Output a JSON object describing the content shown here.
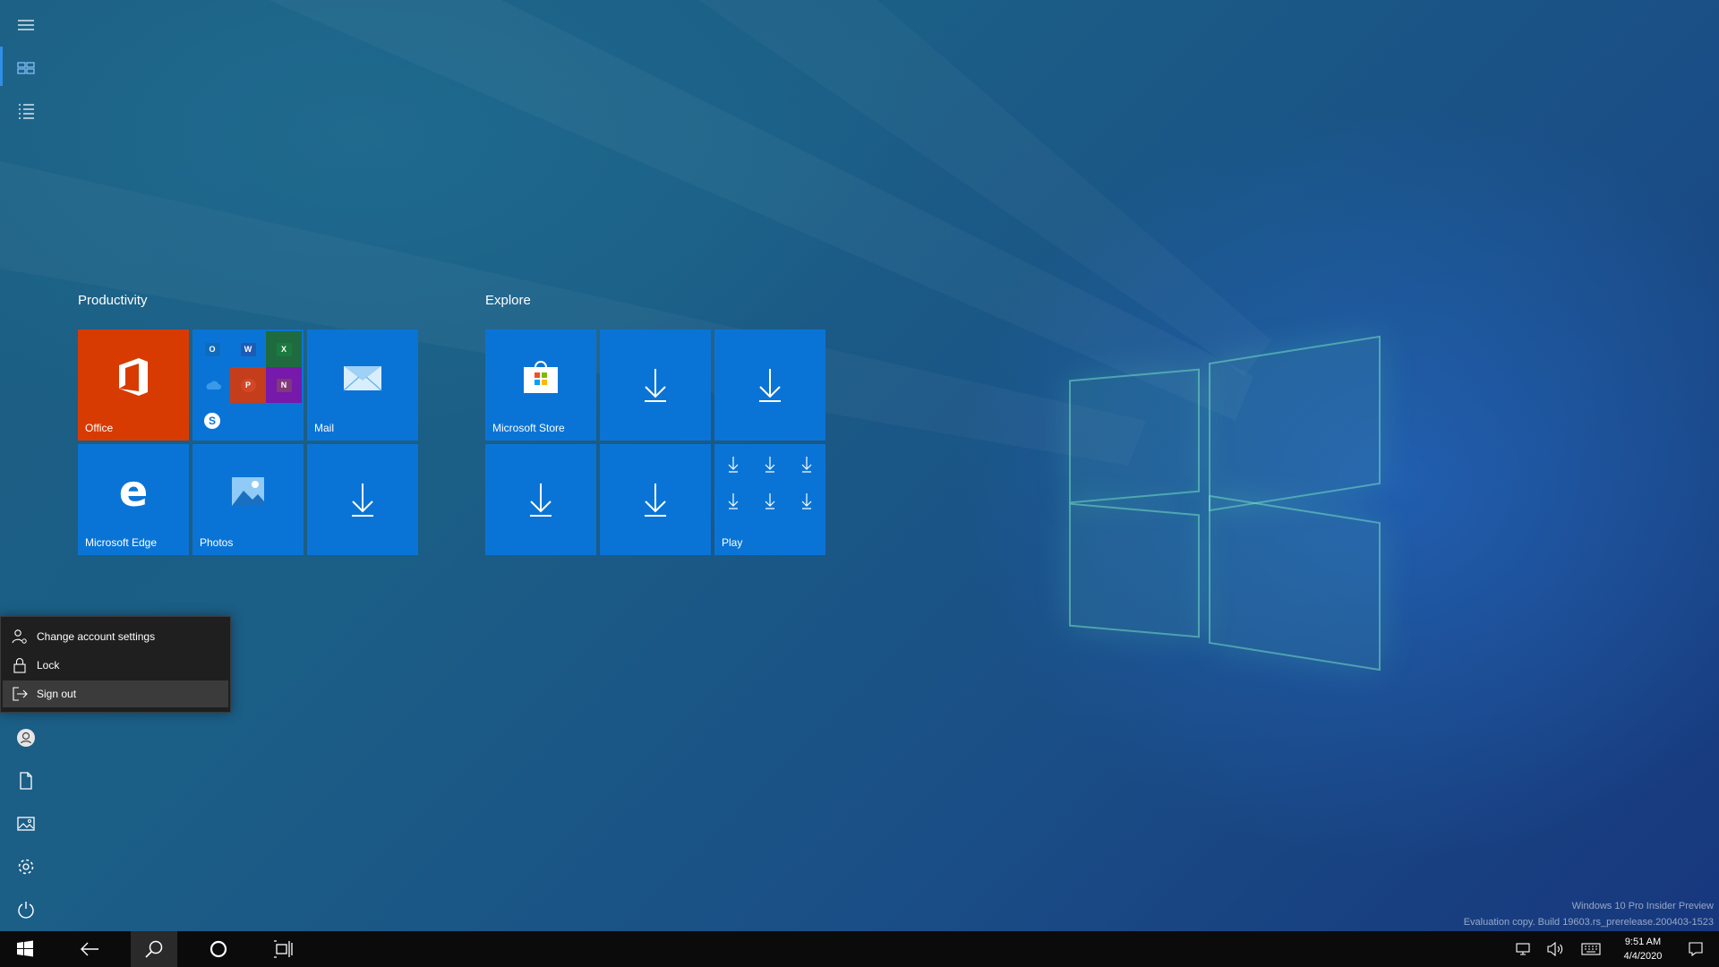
{
  "start_menu": {
    "groups": [
      {
        "title": "Productivity",
        "tiles": [
          {
            "label": "Office",
            "icon": "office-icon"
          },
          {
            "label": "",
            "icon": "office-apps-folder-icon"
          },
          {
            "label": "Mail",
            "icon": "mail-icon"
          },
          {
            "label": "Microsoft Edge",
            "icon": "edge-icon"
          },
          {
            "label": "Photos",
            "icon": "photos-icon"
          },
          {
            "label": "",
            "icon": "download-icon"
          }
        ]
      },
      {
        "title": "Explore",
        "tiles": [
          {
            "label": "Microsoft Store",
            "icon": "store-icon"
          },
          {
            "label": "",
            "icon": "download-icon"
          },
          {
            "label": "",
            "icon": "download-icon"
          },
          {
            "label": "",
            "icon": "download-icon"
          },
          {
            "label": "",
            "icon": "download-icon"
          },
          {
            "label": "Play",
            "icon": "download-folder-icon"
          }
        ]
      }
    ],
    "folder_apps": [
      "O",
      "W",
      "X",
      "",
      "P",
      "N",
      "S"
    ],
    "rail_icons": [
      "hamburger-icon",
      "pinned-tiles-icon",
      "all-apps-list-icon",
      "user-icon",
      "documents-icon",
      "pictures-icon",
      "settings-gear-icon",
      "power-icon"
    ]
  },
  "account_flyout": {
    "items": [
      {
        "label": "Change account settings",
        "icon": "person-settings-icon"
      },
      {
        "label": "Lock",
        "icon": "lock-icon"
      },
      {
        "label": "Sign out",
        "icon": "sign-out-icon"
      }
    ]
  },
  "watermark": {
    "line1": "Windows 10 Pro Insider Preview",
    "line2": "Evaluation copy. Build 19603.rs_prerelease.200403-1523"
  },
  "taskbar": {
    "buttons": [
      "start-icon",
      "back-icon",
      "search-icon",
      "cortana-icon",
      "task-view-icon"
    ],
    "clock": {
      "time": "9:51 AM",
      "date": "4/4/2020"
    }
  },
  "colors": {
    "tile_blue": "#0a74d6",
    "office_orange": "#d83b01",
    "accent": "#2f8ee8",
    "taskbar": "#0b0b0c"
  }
}
